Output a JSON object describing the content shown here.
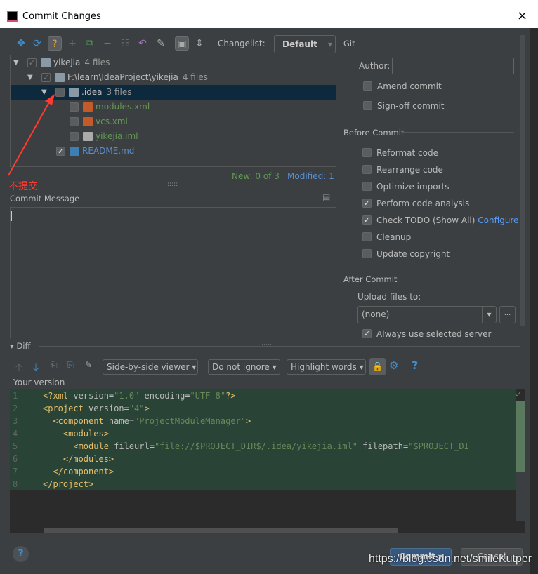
{
  "window": {
    "title": "Commit Changes",
    "close": "×"
  },
  "toolbar": {
    "icons": [
      "move-icon",
      "refresh-icon",
      "unversioned-icon",
      "add-icon",
      "diff-icon",
      "remove-icon",
      "group-icon",
      "rollback-icon",
      "edit-icon",
      "directory-icon",
      "expand-icon"
    ],
    "changelist_label": "Changelist:",
    "changelist_value": "Default"
  },
  "tree": [
    {
      "name": "yikejia",
      "count": "4 files",
      "checked": true,
      "depth": 0
    },
    {
      "name": "F:\\learn\\IdeaProject\\yikejia",
      "count": "4 files",
      "checked": true,
      "depth": 1
    },
    {
      "name": ".idea",
      "count": "3 files",
      "checked": false,
      "depth": 2,
      "selected": true
    },
    {
      "name": "modules.xml",
      "checked": false,
      "depth": 3,
      "status": "new"
    },
    {
      "name": "vcs.xml",
      "checked": false,
      "depth": 3,
      "status": "new"
    },
    {
      "name": "yikejia.iml",
      "checked": false,
      "depth": 3,
      "status": "new"
    },
    {
      "name": "README.md",
      "checked": true,
      "depth": 2,
      "status": "modified"
    }
  ],
  "stats": {
    "new": "New: 0 of 3",
    "modified": "Modified: 1"
  },
  "annotation": {
    "text": "不提交",
    "color": "#ff3b30"
  },
  "commit_message": {
    "label": "Commit Message",
    "value": ""
  },
  "git": {
    "section": "Git",
    "author_label": "Author:",
    "author_value": "",
    "amend": "Amend commit",
    "signoff": "Sign-off commit"
  },
  "before_commit": {
    "section": "Before Commit",
    "options": [
      {
        "label": "Reformat code",
        "checked": false
      },
      {
        "label": "Rearrange code",
        "checked": false
      },
      {
        "label": "Optimize imports",
        "checked": false
      },
      {
        "label": "Perform code analysis",
        "checked": true
      },
      {
        "label": "Check TODO (Show All)",
        "checked": true,
        "link": "Configure"
      },
      {
        "label": "Cleanup",
        "checked": false
      },
      {
        "label": "Update copyright",
        "checked": false
      }
    ]
  },
  "after_commit": {
    "section": "After Commit",
    "upload_label": "Upload files to:",
    "upload_value": "(none)",
    "more": "...",
    "always": "Always use selected server"
  },
  "diff": {
    "section": "Diff",
    "viewer": "Side-by-side viewer",
    "ignore": "Do not ignore",
    "highlight": "Highlight words",
    "help": "?",
    "version_label": "Your version"
  },
  "code": [
    [
      [
        "t",
        "<?xml "
      ],
      [
        "a",
        "version="
      ],
      [
        "s",
        "\"1.0\""
      ],
      [
        "a",
        " encoding="
      ],
      [
        "s",
        "\"UTF-8\""
      ],
      [
        "t",
        "?>"
      ]
    ],
    [
      [
        "t",
        "<project "
      ],
      [
        "a",
        "version="
      ],
      [
        "s",
        "\"4\""
      ],
      [
        "t",
        ">"
      ]
    ],
    [
      [
        "t",
        "  <component "
      ],
      [
        "a",
        "name="
      ],
      [
        "s",
        "\"ProjectModuleManager\""
      ],
      [
        "t",
        ">"
      ]
    ],
    [
      [
        "t",
        "    <modules>"
      ]
    ],
    [
      [
        "t",
        "      <module "
      ],
      [
        "a",
        "fileurl="
      ],
      [
        "s",
        "\"file://$PROJECT_DIR$/.idea/yikejia.iml\""
      ],
      [
        "a",
        " filepath="
      ],
      [
        "s",
        "\"$PROJECT_DI"
      ]
    ],
    [
      [
        "t",
        "    </modules>"
      ]
    ],
    [
      [
        "t",
        "  </component>"
      ]
    ],
    [
      [
        "t",
        "</project>"
      ]
    ]
  ],
  "footer": {
    "help": "?",
    "commit": "Commit",
    "cancel": "Cancel"
  },
  "watermark": "https://blog.csdn.net/smileKutper",
  "colors": {
    "background": "#3c3f41",
    "selection": "#0d293e",
    "added_bg": "#294436",
    "new_file": "#629755",
    "modified_file": "#5a8fce",
    "link": "#589df6"
  }
}
